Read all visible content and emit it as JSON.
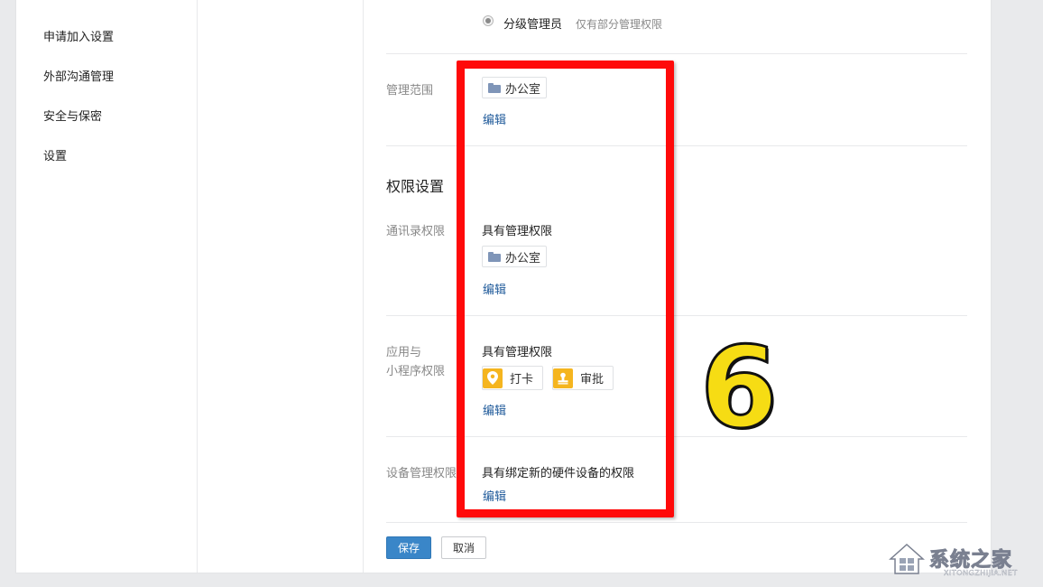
{
  "sidebar": {
    "items": [
      {
        "label": "申请加入设置"
      },
      {
        "label": "外部沟通管理"
      },
      {
        "label": "安全与保密"
      },
      {
        "label": "设置"
      }
    ]
  },
  "admin_type": {
    "option_label": "分级管理员",
    "option_desc": "仅有部分管理权限"
  },
  "scope": {
    "label": "管理范围",
    "chip": "办公室",
    "edit": "编辑"
  },
  "permissions": {
    "title": "权限设置",
    "contacts": {
      "label": "通讯录权限",
      "status": "具有管理权限",
      "chip": "办公室",
      "edit": "编辑"
    },
    "apps": {
      "label_line1": "应用与",
      "label_line2": "小程序权限",
      "status": "具有管理权限",
      "app1": "打卡",
      "app2": "审批",
      "edit": "编辑"
    },
    "devices": {
      "label": "设备管理权限",
      "status": "具有绑定新的硬件设备的权限",
      "edit": "编辑"
    }
  },
  "buttons": {
    "save": "保存",
    "cancel": "取消"
  },
  "annotation": {
    "number": "6"
  },
  "watermark": {
    "text": "系统之家",
    "url": "XITONGZHIJIA.NET"
  },
  "colors": {
    "accent": "#3a86c8",
    "link": "#1f5a9a",
    "highlight_box": "#ff0a0a",
    "annotation_number": "#f6dc14",
    "app_icon": "#f5b51f"
  }
}
